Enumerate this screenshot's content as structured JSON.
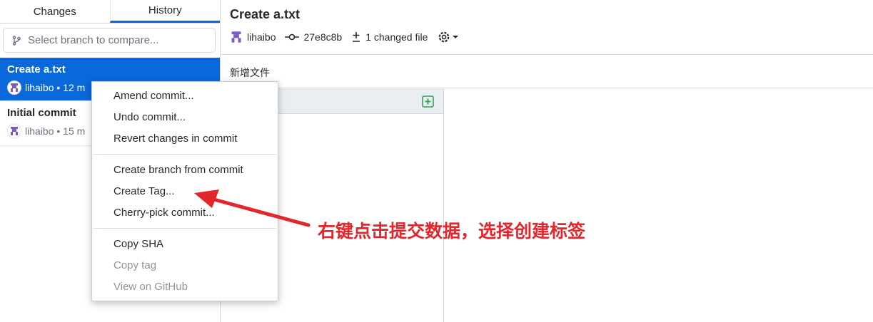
{
  "sidebar": {
    "tabs": [
      {
        "label": "Changes"
      },
      {
        "label": "History"
      }
    ],
    "branch_filter": {
      "placeholder": "Select branch to compare..."
    },
    "commits": [
      {
        "title": "Create a.txt",
        "author": "lihaibo",
        "time": "• 12 m"
      },
      {
        "title": "Initial commit",
        "author": "lihaibo",
        "time": "• 15 m"
      }
    ]
  },
  "main": {
    "title": "Create a.txt",
    "author": "lihaibo",
    "sha": "27e8c8b",
    "changed_files": "1 changed file",
    "description": "新增文件"
  },
  "context_menu": {
    "items": [
      {
        "label": "Amend commit..."
      },
      {
        "label": "Undo commit..."
      },
      {
        "label": "Revert changes in commit"
      },
      {
        "label": "Create branch from commit"
      },
      {
        "label": "Create Tag..."
      },
      {
        "label": "Cherry-pick commit..."
      },
      {
        "label": "Copy SHA"
      },
      {
        "label": "Copy tag"
      },
      {
        "label": "View on GitHub"
      }
    ]
  },
  "annotation": {
    "text": "右键点击提交数据，选择创建标签",
    "color": "#e3262c"
  },
  "colors": {
    "accent": "#0969da",
    "add_green": "#2da44e",
    "avatar_purple": "#7b5ac2"
  }
}
